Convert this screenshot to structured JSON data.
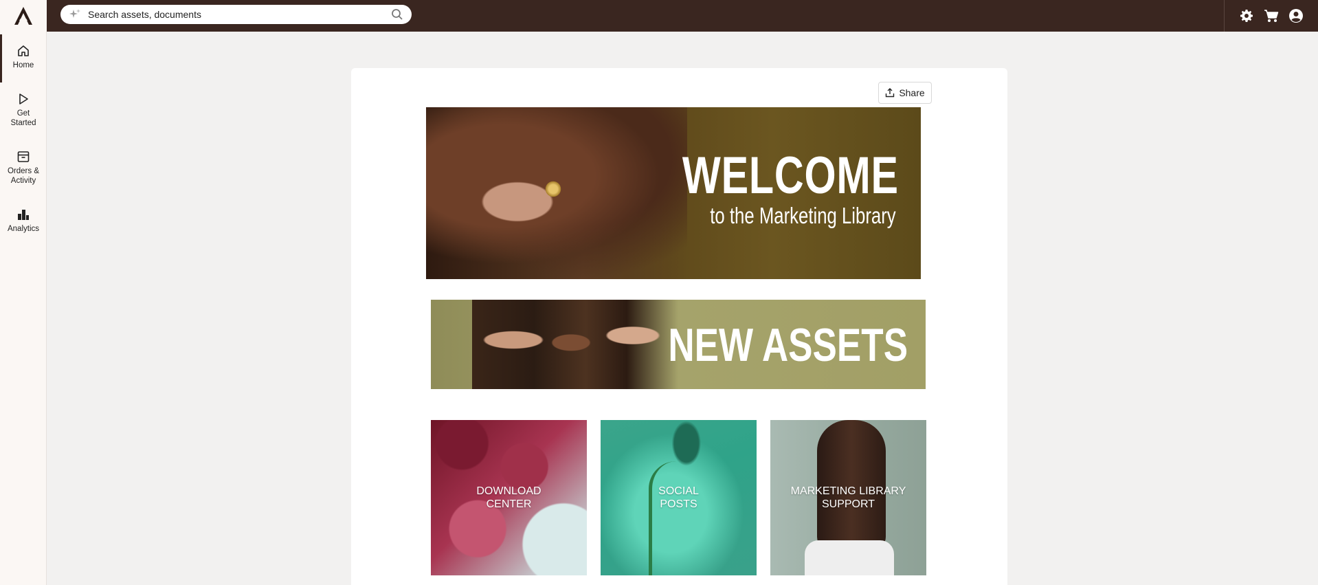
{
  "app": {
    "logo": "logo-icon"
  },
  "search": {
    "placeholder": "Search assets, documents",
    "value": ""
  },
  "top_icons": [
    "gear-icon",
    "cart-icon",
    "account-icon"
  ],
  "sidebar": {
    "items": [
      {
        "label": "Home",
        "icon": "home-icon",
        "active": true
      },
      {
        "label": "Get\nStarted",
        "icon": "play-icon",
        "active": false
      },
      {
        "label": "Orders &\nActivity",
        "icon": "archive-icon",
        "active": false
      },
      {
        "label": "Analytics",
        "icon": "analytics-icon",
        "active": false
      }
    ]
  },
  "main": {
    "share_label": "Share",
    "welcome": {
      "title": "WELCOME",
      "subtitle": "to the Marketing Library"
    },
    "new_assets": {
      "title": "NEW ASSETS"
    },
    "tiles": [
      {
        "label": "DOWNLOAD\nCENTER"
      },
      {
        "label": "SOCIAL\nPOSTS"
      },
      {
        "label": "MARKETING LIBRARY\nSUPPORT"
      }
    ]
  },
  "colors": {
    "topbar": "#3a2620",
    "sidebar": "#fbf7f4",
    "page_bg": "#f2f1f0"
  }
}
